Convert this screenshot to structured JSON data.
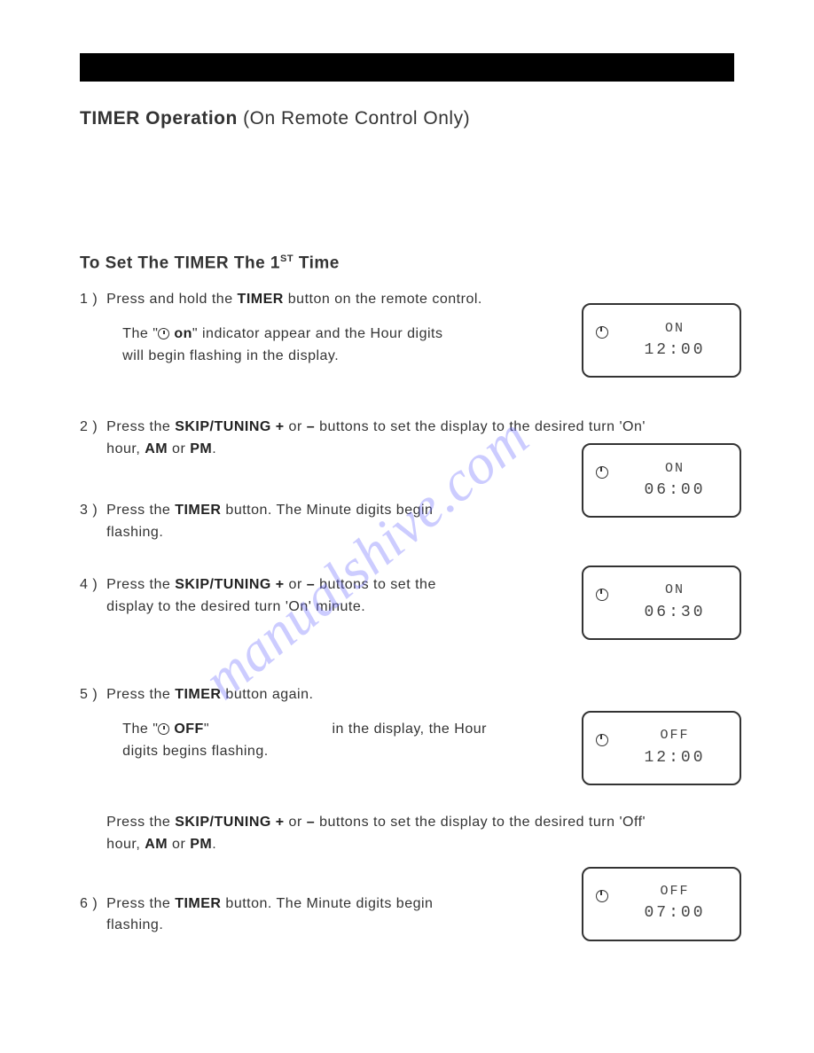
{
  "title": {
    "bold": "TIMER Operation",
    "rest": " (On Remote Control Only)"
  },
  "section_heading": {
    "pre": "To Set The TIMER The 1",
    "sup": "ST",
    "post": " Time"
  },
  "steps": {
    "s1": {
      "num": "1 )",
      "line": "Press and hold the <b>TIMER</b> button on the remote control.",
      "sub": "The \"<span class='clock-icon' data-name='clock-icon' data-interactable='false'></span> <b>on</b>\" indicator  appear and the Hour digits will begin flashing in the display.",
      "lcd1": "ON",
      "lcd2": "12:00"
    },
    "s2": {
      "num": "2 )",
      "line": "Press the <b>SKIP/TUNING +</b> or <b>–</b> buttons to set the display to the desired turn 'On' hour, <b>AM</b> or <b>PM</b>.",
      "lcd1": "ON",
      "lcd2": "06:00"
    },
    "s3": {
      "num": "3 )",
      "line": "Press the <b>TIMER</b> button. The Minute digits begin flashing."
    },
    "s4": {
      "num": "4 )",
      "line": "Press the <b>SKIP/TUNING +</b> or <b>–</b> buttons to set the display to the desired turn 'On' minute.",
      "lcd1": "ON",
      "lcd2": "06:30"
    },
    "s5": {
      "num": "5 )",
      "line": "Press the <b>TIMER</b> button again.",
      "sub": "The \"<span class='clock-icon' data-name='clock-icon' data-interactable='false'></span> <b>OFF</b>\" &nbsp;&nbsp;&nbsp;&nbsp;&nbsp;&nbsp;&nbsp;&nbsp;&nbsp;&nbsp;&nbsp;&nbsp;&nbsp;&nbsp;&nbsp;&nbsp;&nbsp;&nbsp;&nbsp;&nbsp;&nbsp;&nbsp;&nbsp;&nbsp;&nbsp;&nbsp; in the display, the Hour digits begins flashing.",
      "lcd1": "OFF",
      "lcd2": "12:00",
      "extra": "Press the <b>SKIP/TUNING +</b> or <b>–</b> buttons to set the display to the desired turn 'Off' hour, <b>AM</b> or <b>PM</b>."
    },
    "s6": {
      "num": "6 )",
      "line": "Press the <b>TIMER</b> button. The Minute digits begin flashing.",
      "lcd1": "OFF",
      "lcd2": "07:00"
    }
  },
  "watermark": "manualshive.com"
}
